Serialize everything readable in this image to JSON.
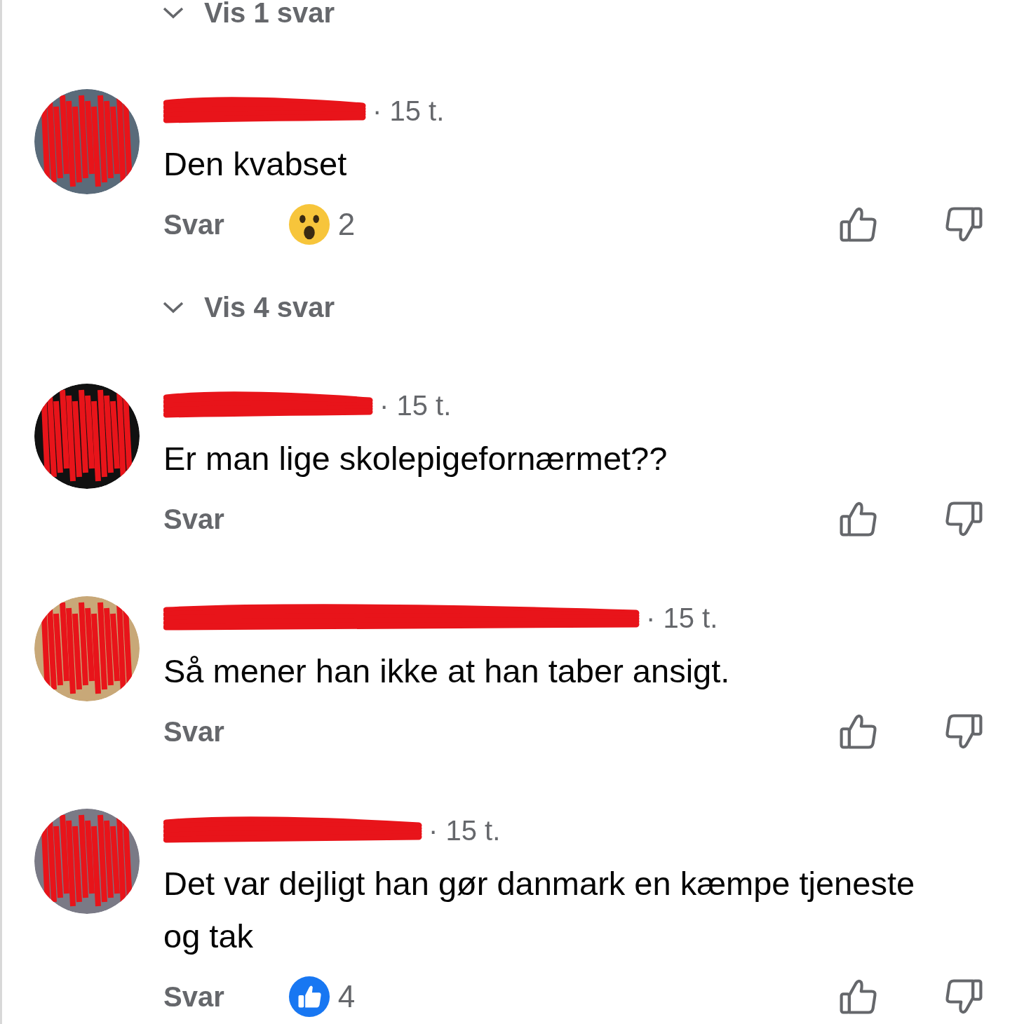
{
  "thread": [
    {
      "kind": "replies_toggle",
      "label": "Vis 1 svar"
    },
    {
      "kind": "comment",
      "time": "· 15 t.",
      "text": "Den kvabset",
      "reply": "Svar",
      "reaction": {
        "kind": "wow",
        "count": "2"
      }
    },
    {
      "kind": "replies_toggle",
      "label": "Vis 4 svar"
    },
    {
      "kind": "comment",
      "time": "· 15 t.",
      "text": "Er man lige skolepigefornærmet??",
      "reply": "Svar"
    },
    {
      "kind": "comment",
      "time": "· 15 t.",
      "text": "Så mener han ikke at han taber ansigt.",
      "reply": "Svar"
    },
    {
      "kind": "comment",
      "time": "· 15 t.",
      "text": "Det var dejligt han gør danmark en kæmpe tjeneste og tak",
      "reply": "Svar",
      "reaction": {
        "kind": "like",
        "count": "4"
      }
    }
  ]
}
